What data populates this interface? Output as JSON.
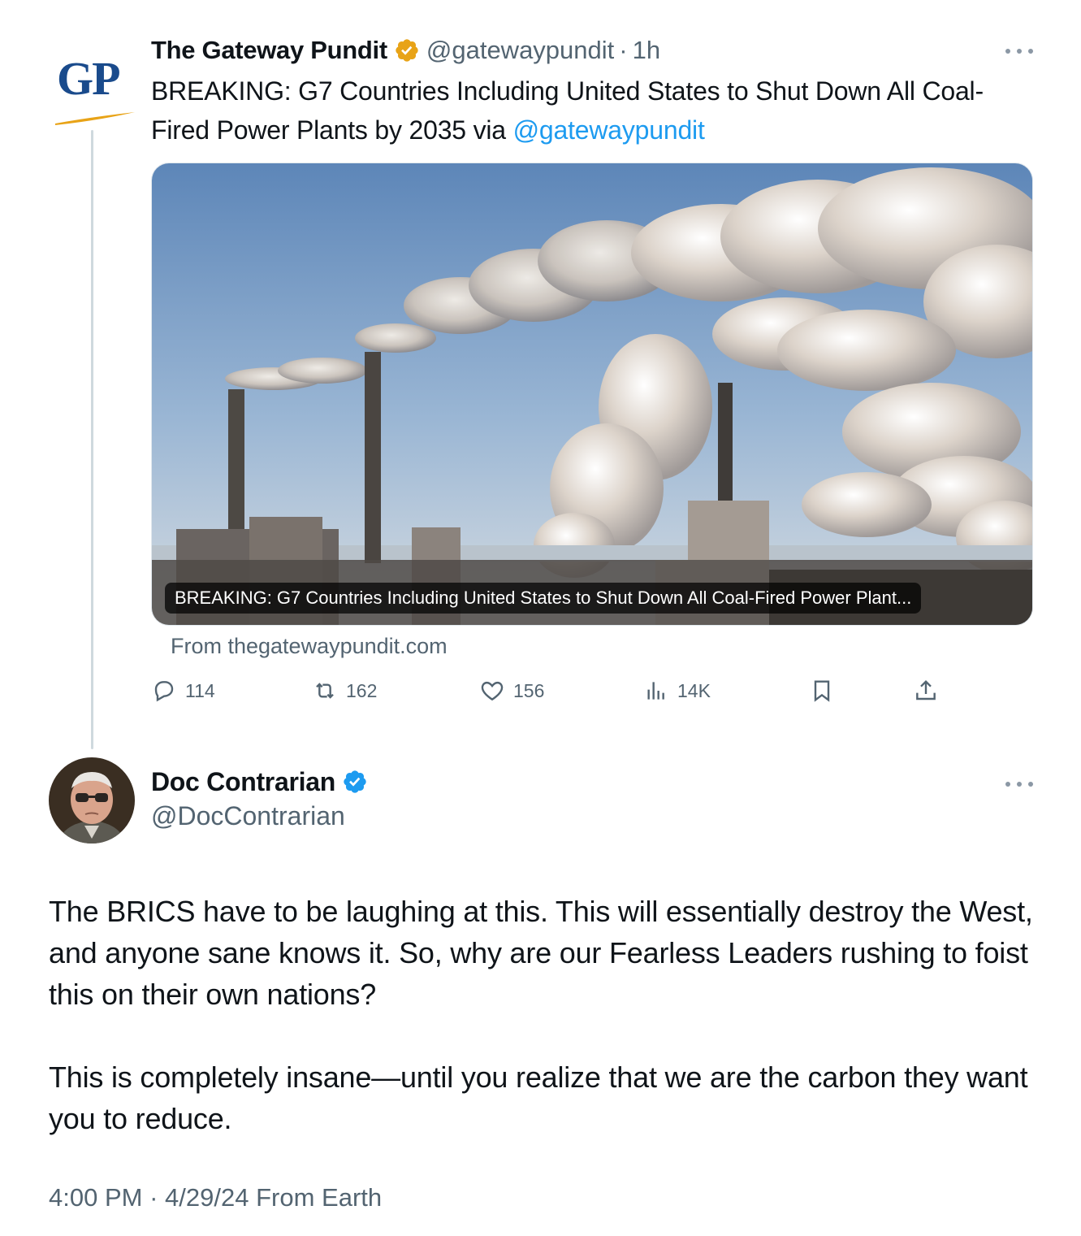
{
  "original_tweet": {
    "avatar_text": "GP",
    "display_name": "The Gateway Pundit",
    "handle": "@gatewaypundit",
    "separator": "·",
    "time": "1h",
    "text": "BREAKING: G7 Countries Including United States to Shut Down All Coal-Fired Power Plants by 2035 via ",
    "mention": "@gatewaypundit",
    "badge_color": "#e8a317",
    "card": {
      "caption": "BREAKING: G7 Countries Including United States to Shut Down All Coal-Fired Power Plant...",
      "source": "From thegatewaypundit.com"
    },
    "actions": {
      "replies": "114",
      "reposts": "162",
      "likes": "156",
      "views": "14K"
    }
  },
  "reply_tweet": {
    "display_name": "Doc Contrarian",
    "handle": "@DocContrarian",
    "badge_color": "#1d9bf0",
    "paragraphs": [
      "The BRICS have to be laughing at this. This will essentially destroy the West, and anyone sane knows it. So, why are our Fearless Leaders rushing to foist this on their own nations?",
      "This is completely insane—until you realize that we are the carbon they want you to reduce."
    ],
    "time": "4:00 PM",
    "separator": "·",
    "date": "4/29/24",
    "source": "From Earth"
  },
  "icons": [
    "more-icon",
    "verified-gold-icon",
    "verified-blue-icon",
    "reply-icon",
    "repost-icon",
    "like-icon",
    "views-icon",
    "bookmark-icon",
    "share-icon"
  ]
}
